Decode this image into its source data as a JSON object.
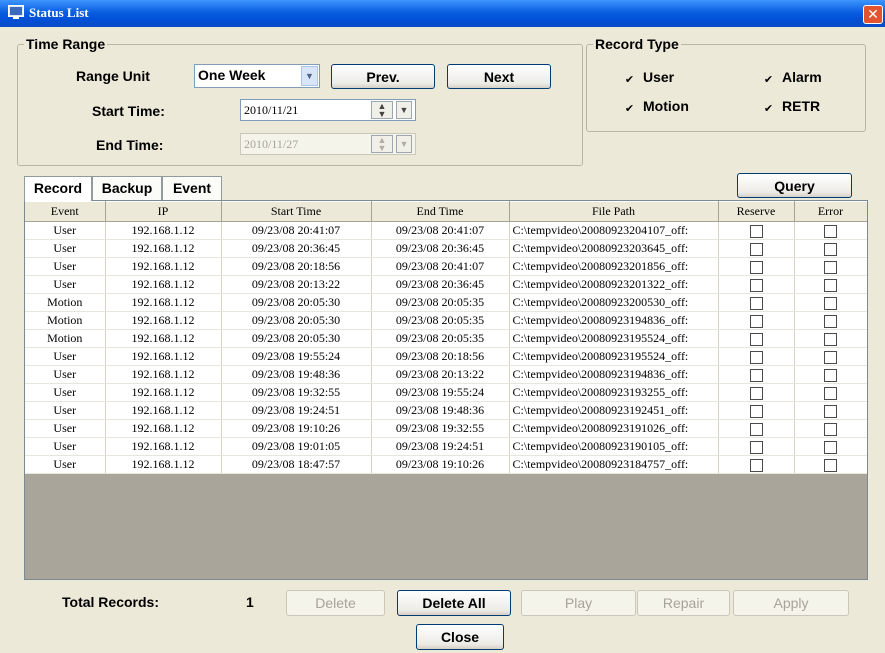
{
  "window": {
    "title": "Status List",
    "close_glyph": "✕",
    "icon": "app-icon"
  },
  "time_range": {
    "legend": "Time Range",
    "range_unit_label": "Range Unit",
    "range_unit_value": "One Week",
    "prev_label": "Prev.",
    "next_label": "Next",
    "start_time_label": "Start Time:",
    "start_time_value": "2010/11/21",
    "end_time_label": "End Time:",
    "end_time_value": "2010/11/27"
  },
  "record_type": {
    "legend": "Record Type",
    "options": [
      {
        "label": "User",
        "checked": true
      },
      {
        "label": "Alarm",
        "checked": true
      },
      {
        "label": "Motion",
        "checked": true
      },
      {
        "label": "RETR",
        "checked": true
      }
    ]
  },
  "tabs": [
    {
      "label": "Record",
      "active": true
    },
    {
      "label": "Backup",
      "active": false
    },
    {
      "label": "Event",
      "active": false
    }
  ],
  "query_label": "Query",
  "table": {
    "columns": [
      "Event",
      "IP",
      "Start Time",
      "End Time",
      "File Path",
      "Reserve",
      "Error"
    ],
    "rows": [
      [
        "User",
        "192.168.1.12",
        "09/23/08 20:41:07",
        "09/23/08 20:41:07",
        "C:\\tempvideo\\20080923204107_off:"
      ],
      [
        "User",
        "192.168.1.12",
        "09/23/08 20:36:45",
        "09/23/08 20:36:45",
        "C:\\tempvideo\\20080923203645_off:"
      ],
      [
        "User",
        "192.168.1.12",
        "09/23/08 20:18:56",
        "09/23/08 20:41:07",
        "C:\\tempvideo\\20080923201856_off:"
      ],
      [
        "User",
        "192.168.1.12",
        "09/23/08 20:13:22",
        "09/23/08 20:36:45",
        "C:\\tempvideo\\20080923201322_off:"
      ],
      [
        "Motion",
        "192.168.1.12",
        "09/23/08 20:05:30",
        "09/23/08 20:05:35",
        "C:\\tempvideo\\20080923200530_off:"
      ],
      [
        "Motion",
        "192.168.1.12",
        "09/23/08 20:05:30",
        "09/23/08 20:05:35",
        "C:\\tempvideo\\20080923194836_off:"
      ],
      [
        "Motion",
        "192.168.1.12",
        "09/23/08 20:05:30",
        "09/23/08 20:05:35",
        "C:\\tempvideo\\20080923195524_off:"
      ],
      [
        "User",
        "192.168.1.12",
        "09/23/08 19:55:24",
        "09/23/08 20:18:56",
        "C:\\tempvideo\\20080923195524_off:"
      ],
      [
        "User",
        "192.168.1.12",
        "09/23/08 19:48:36",
        "09/23/08 20:13:22",
        "C:\\tempvideo\\20080923194836_off:"
      ],
      [
        "User",
        "192.168.1.12",
        "09/23/08 19:32:55",
        "09/23/08 19:55:24",
        "C:\\tempvideo\\20080923193255_off:"
      ],
      [
        "User",
        "192.168.1.12",
        "09/23/08 19:24:51",
        "09/23/08 19:48:36",
        "C:\\tempvideo\\20080923192451_off:"
      ],
      [
        "User",
        "192.168.1.12",
        "09/23/08 19:10:26",
        "09/23/08 19:32:55",
        "C:\\tempvideo\\20080923191026_off:"
      ],
      [
        "User",
        "192.168.1.12",
        "09/23/08 19:01:05",
        "09/23/08 19:24:51",
        "C:\\tempvideo\\20080923190105_off:"
      ],
      [
        "User",
        "192.168.1.12",
        "09/23/08 18:47:57",
        "09/23/08 19:10:26",
        "C:\\tempvideo\\20080923184757_off:"
      ]
    ]
  },
  "footer": {
    "total_label": "Total Records:",
    "total_value": "1",
    "delete_label": "Delete",
    "delete_all_label": "Delete All",
    "play_label": "Play",
    "repair_label": "Repair",
    "apply_label": "Apply",
    "close_label": "Close"
  },
  "colors": {
    "titlebar": "#0a5fe0",
    "dialog_bg": "#ece9d8",
    "grid_empty": "#a9a59a"
  }
}
